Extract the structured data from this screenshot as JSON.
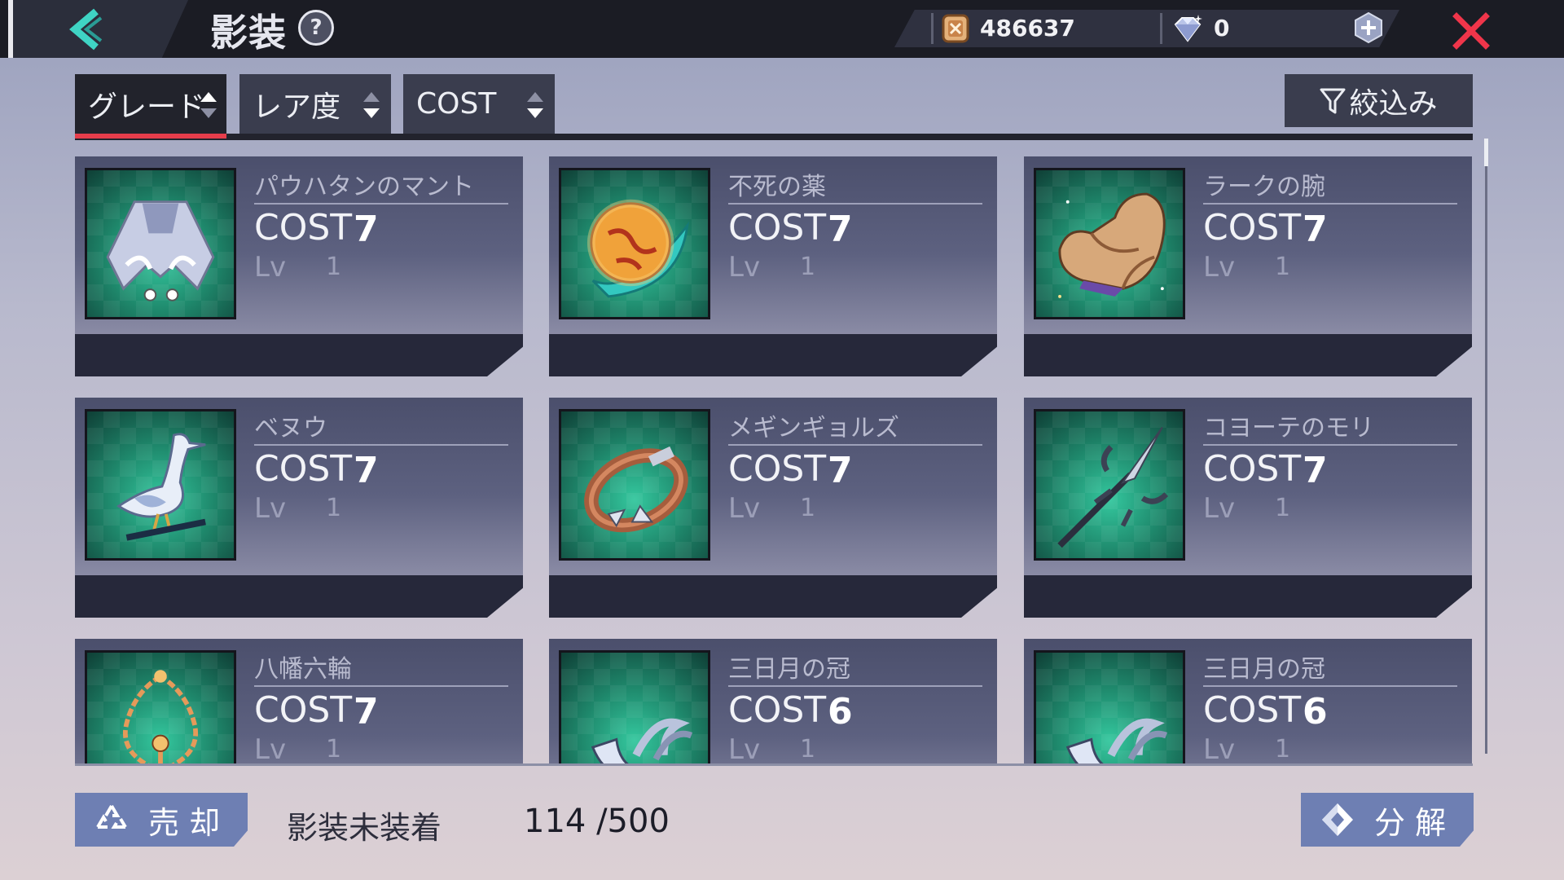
{
  "header": {
    "title": "影装",
    "help_label": "?",
    "coins": "486637",
    "gems": "0",
    "icons": [
      "back-arrow-icon",
      "help-icon",
      "coin-icon",
      "gem-icon",
      "plus-icon",
      "close-icon"
    ],
    "accent_color": "#e63d4b"
  },
  "sort": {
    "tabs": [
      {
        "label": "グレード",
        "active": true
      },
      {
        "label": "レア度",
        "active": false
      },
      {
        "label": "COST",
        "active": false
      }
    ],
    "filter_label": "絞込み"
  },
  "items": [
    {
      "name": "パウハタンのマント",
      "cost_label": "COST",
      "cost": "7",
      "lv_label": "Lv",
      "lv": "1",
      "icon": "cape-icon"
    },
    {
      "name": "不死の薬",
      "cost_label": "COST",
      "cost": "7",
      "lv_label": "Lv",
      "lv": "1",
      "icon": "elixir-orb-icon"
    },
    {
      "name": "ラークの腕",
      "cost_label": "COST",
      "cost": "7",
      "lv_label": "Lv",
      "lv": "1",
      "icon": "arm-icon"
    },
    {
      "name": "ベヌウ",
      "cost_label": "COST",
      "cost": "7",
      "lv_label": "Lv",
      "lv": "1",
      "icon": "heron-icon"
    },
    {
      "name": "メギンギョルズ",
      "cost_label": "COST",
      "cost": "7",
      "lv_label": "Lv",
      "lv": "1",
      "icon": "belt-icon"
    },
    {
      "name": "コヨーテのモリ",
      "cost_label": "COST",
      "cost": "7",
      "lv_label": "Lv",
      "lv": "1",
      "icon": "spear-icon"
    },
    {
      "name": "八幡六輪",
      "cost_label": "COST",
      "cost": "7",
      "lv_label": "Lv",
      "lv": "1",
      "icon": "prayer-beads-icon"
    },
    {
      "name": "三日月の冠",
      "cost_label": "COST",
      "cost": "6",
      "lv_label": "Lv",
      "lv": "1",
      "icon": "crescent-crown-icon"
    },
    {
      "name": "三日月の冠",
      "cost_label": "COST",
      "cost": "6",
      "lv_label": "Lv",
      "lv": "1",
      "icon": "crescent-crown-icon"
    }
  ],
  "footer": {
    "sell_label": "売 却",
    "status_label": "影装未装着",
    "count": "114 /500",
    "dismantle_label": "分 解"
  }
}
